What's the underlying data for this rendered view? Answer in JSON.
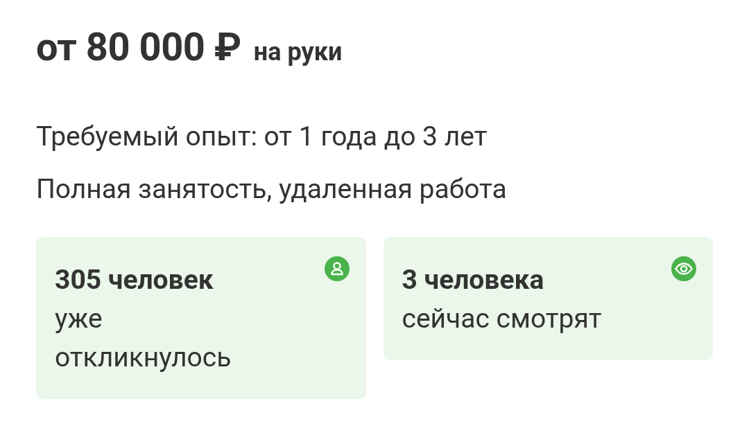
{
  "salary": {
    "amount": "от 80 000 ₽",
    "note": "на руки"
  },
  "details": [
    "Требуемый опыт: от 1 года до 3 лет",
    "Полная занятость, удаленная работа"
  ],
  "stats": [
    {
      "kind": "responses",
      "title": "305 человек",
      "text": "уже откликнулось"
    },
    {
      "kind": "viewers",
      "title": "3 человека",
      "text": "сейчас смотрят"
    }
  ]
}
